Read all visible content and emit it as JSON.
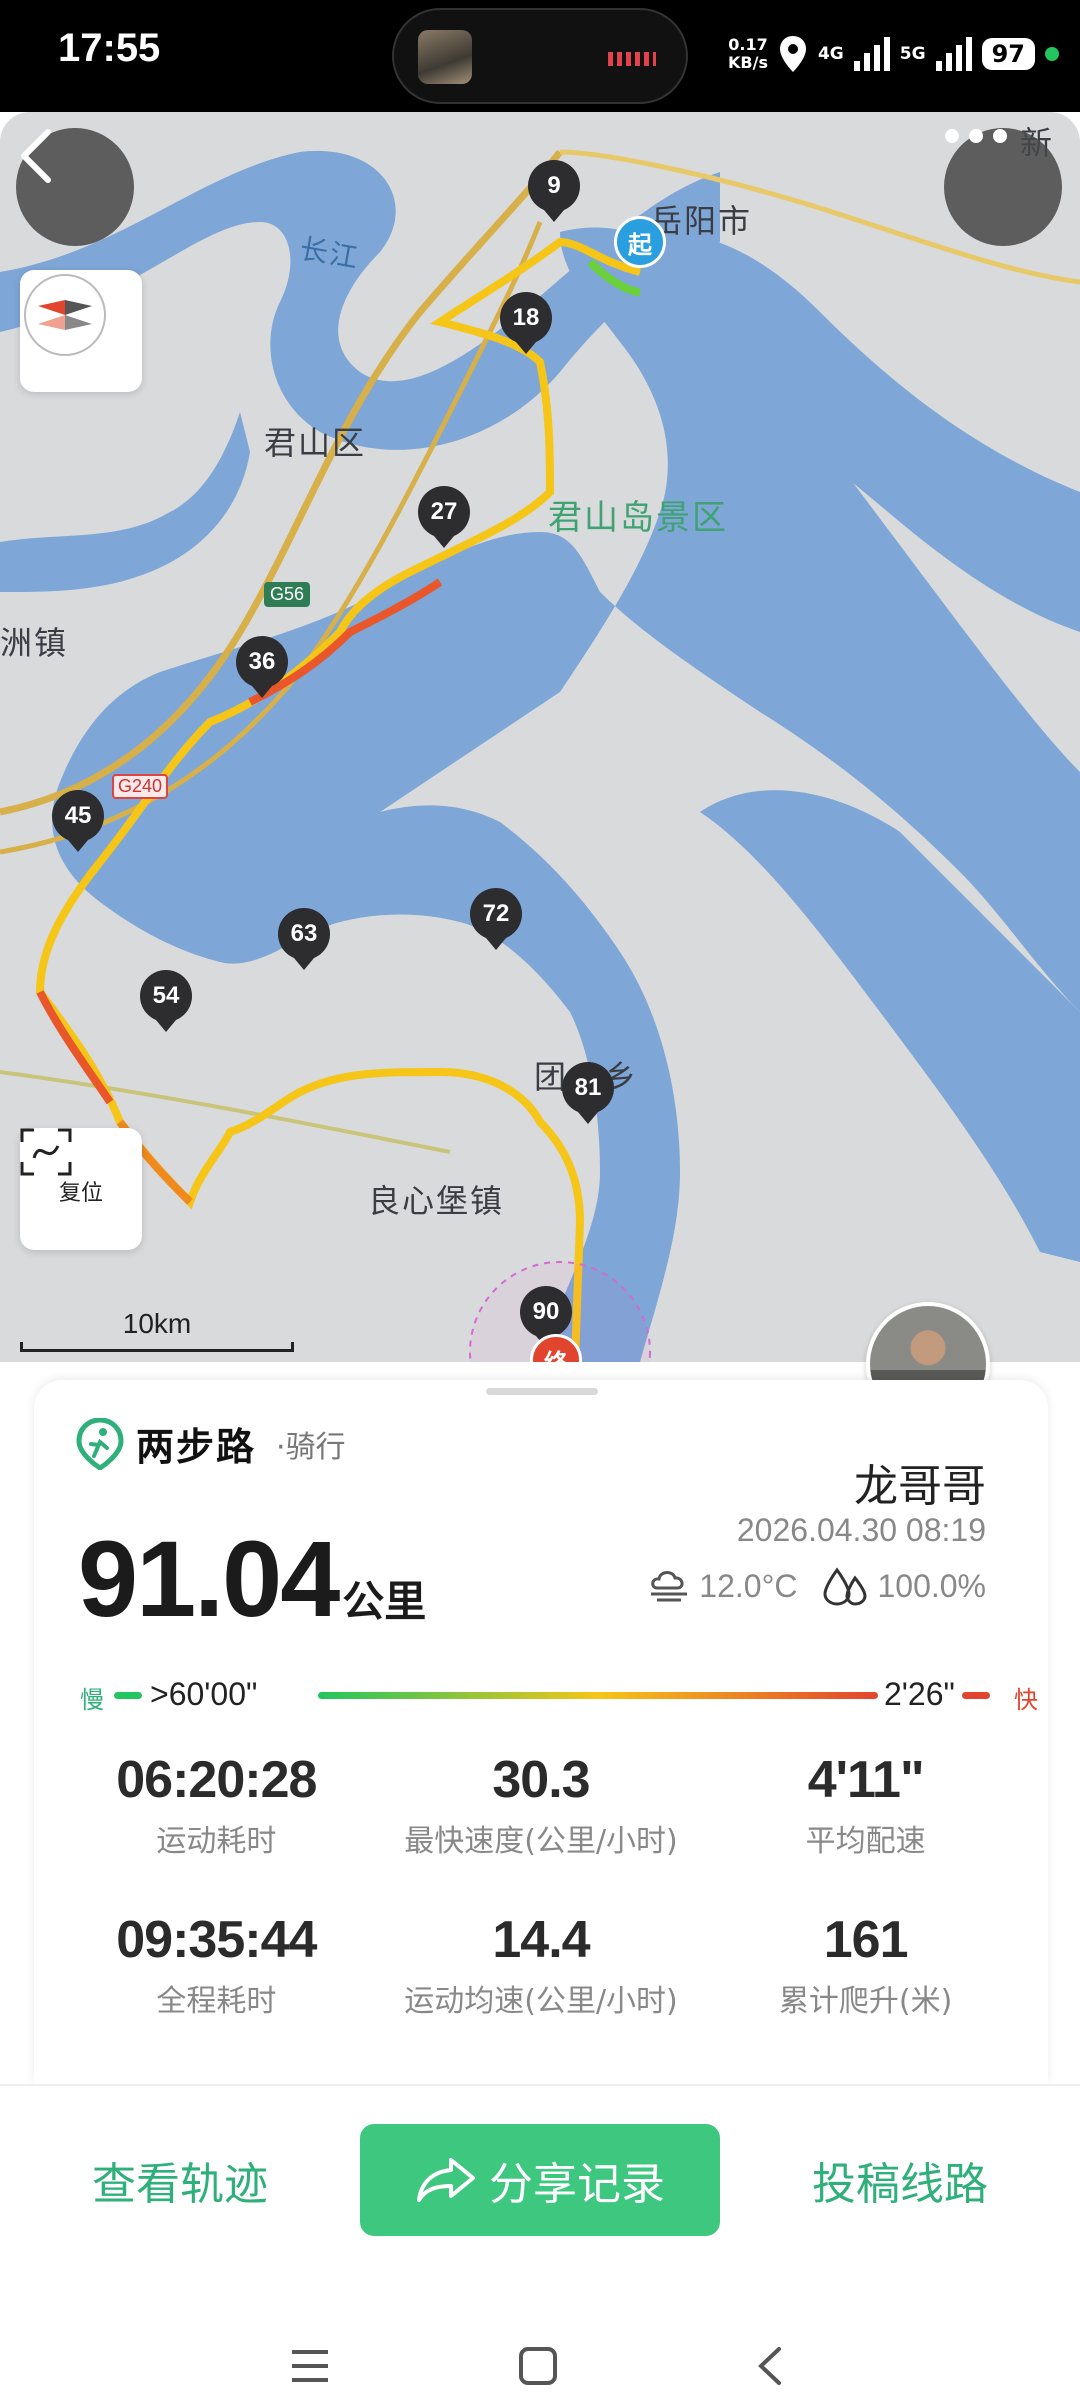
{
  "status_bar": {
    "time": "17:55",
    "net_speed_value": "0.17",
    "net_speed_unit": "KB/s",
    "network_4g": "4G",
    "network_5g": "5G",
    "battery": "97"
  },
  "map": {
    "labels": {
      "city": "岳阳市",
      "river": "长江",
      "district": "君山区",
      "scenic": "君山岛景区",
      "town_left": "洲镇",
      "town_south": "良心堡镇",
      "township": "团",
      "township_suffix": "乡",
      "corner": "新"
    },
    "road_badges": [
      "G56",
      "G240"
    ],
    "markers": [
      "9",
      "18",
      "27",
      "36",
      "45",
      "54",
      "63",
      "72",
      "81",
      "90"
    ],
    "start_label": "起",
    "end_label": "终",
    "scale": "10km",
    "reset_label": "复位"
  },
  "card": {
    "brand": "两步路",
    "activity_type": "·骑行",
    "username": "龙哥哥",
    "datetime": "2026.04.30 08:19",
    "distance_value": "91.04",
    "distance_unit": "公里",
    "temperature": "12.0°C",
    "humidity": "100.0%",
    "pace_legend": {
      "slow_label": "慢",
      "slow_value": ">60'00\"",
      "fast_value": "2'26\"",
      "fast_label": "快"
    },
    "stats": [
      {
        "value": "06:20:28",
        "label": "运动耗时"
      },
      {
        "value": "30.3",
        "label": "最快速度(公里/小时)"
      },
      {
        "value": "4'11\"",
        "label": "平均配速"
      },
      {
        "value": "09:35:44",
        "label": "全程耗时"
      },
      {
        "value": "14.4",
        "label": "运动均速(公里/小时)"
      },
      {
        "value": "161",
        "label": "累计爬升(米)"
      }
    ]
  },
  "actions": {
    "view_track": "查看轨迹",
    "share_record": "分享记录",
    "submit_route": "投稿线路"
  },
  "colors": {
    "accent": "#3ec77f",
    "water": "#7ea6d6",
    "track_fast": "#e2452d",
    "track_slow": "#22c55e"
  }
}
